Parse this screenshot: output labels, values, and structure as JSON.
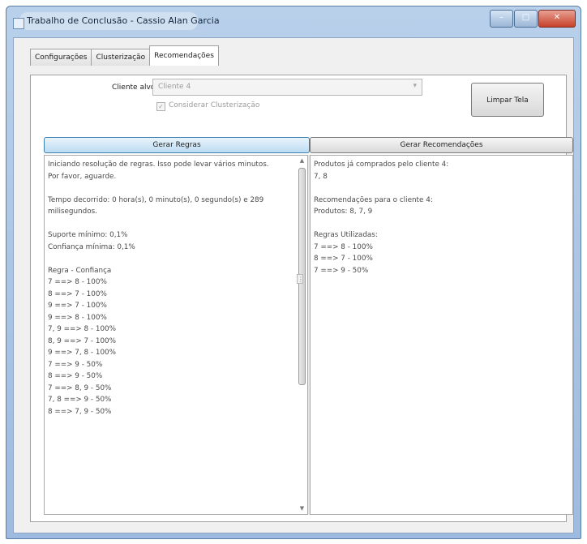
{
  "window": {
    "title": "Trabalho de Conclusão - Cassio Alan Garcia",
    "controls": {
      "minimize": "–",
      "maximize": "□",
      "close": "✕"
    }
  },
  "tabs": [
    {
      "label": "Configurações"
    },
    {
      "label": "Clusterização"
    },
    {
      "label": "Recomendações",
      "active": true
    }
  ],
  "form": {
    "cliente_label": "Cliente alvo:",
    "cliente_value": "Cliente 4",
    "considerar_clusterizacao": {
      "label": "Considerar Clusterização",
      "checked": true
    }
  },
  "buttons": {
    "limpar_tela": "Limpar Tela",
    "gerar_regras": "Gerar Regras",
    "gerar_recomendacoes": "Gerar Recomendações"
  },
  "output_left": {
    "lines": [
      "Iniciando resolução de regras. Isso pode levar vários minutos.",
      "Por favor, aguarde.",
      "",
      "Tempo decorrido: 0 hora(s), 0 minuto(s), 0 segundo(s) e 289",
      "milisegundos.",
      "",
      "Suporte mínimo: 0,1%",
      "Confiança mínima: 0,1%",
      "",
      "Regra - Confiança",
      "7 ==> 8 - 100%",
      "8 ==> 7 - 100%",
      "9 ==> 7 - 100%",
      "9 ==> 8 - 100%",
      "7, 9 ==> 8 - 100%",
      "8, 9 ==> 7 - 100%",
      "9 ==> 7, 8 - 100%",
      "7 ==> 9 - 50%",
      "8 ==> 9 - 50%",
      "7 ==> 8, 9 - 50%",
      "7, 8 ==> 9 - 50%",
      "8 ==> 7, 9 - 50%"
    ]
  },
  "output_right": {
    "lines": [
      "Produtos já comprados pelo cliente 4:",
      "7, 8",
      "",
      "Recomendações para o cliente 4:",
      "Produtos: 8, 7, 9",
      "",
      "Regras Utilizadas:",
      "7 ==> 8 - 100%",
      "8 ==> 7 - 100%",
      "7 ==> 9 - 50%"
    ]
  },
  "icons": {
    "dropdown": "▾",
    "scroll_up": "▲",
    "scroll_down": "▼",
    "splitter_grip": "⋮",
    "checkmark": "✓"
  }
}
